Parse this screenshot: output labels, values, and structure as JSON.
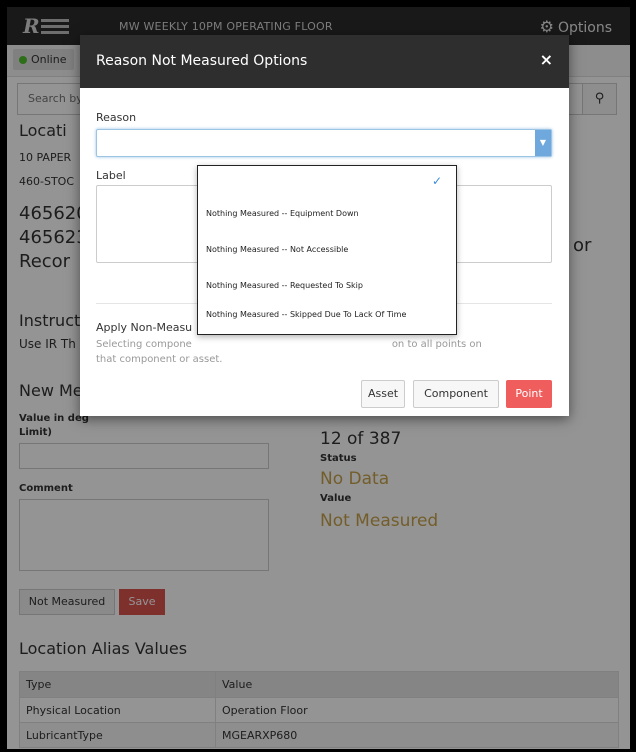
{
  "nav": {
    "logo_text": "Reliable Logic",
    "title": "MW WEEKLY 10PM OPERATING FLOOR",
    "options_label": "Options",
    "options_icon": "gear-icon"
  },
  "status": {
    "online_label": "Online",
    "online_color": "#4fbf2a"
  },
  "search": {
    "placeholder": "Search by",
    "button_icon": "search-icon"
  },
  "location": {
    "heading": "Locati",
    "line1": "10 PAPER",
    "line2": "460-STOC",
    "code1": "465620",
    "code2": "465623",
    "record": "Recor",
    "right_fragment": "or"
  },
  "instructions": {
    "heading": "Instruct",
    "text": "Use IR Th"
  },
  "new_measurement": {
    "heading": "New Me",
    "value_label_a": "Value in deg",
    "value_label_b": "Limit)",
    "comment_label": "Comment",
    "not_measured_button": "Not Measured",
    "save_button": "Save"
  },
  "point_info": {
    "count": "12 of 387",
    "status_label": "Status",
    "status_value": "No Data",
    "value_label": "Value",
    "value_value": "Not Measured"
  },
  "alias": {
    "heading": "Location Alias Values",
    "columns": [
      "Type",
      "Value"
    ],
    "rows": [
      [
        "Physical Location",
        "Operation Floor"
      ],
      [
        "LubricantType",
        "MGEARXP680"
      ]
    ]
  },
  "modal": {
    "title": "Reason Not Measured Options",
    "close_label": "×",
    "reason_label": "Reason",
    "label_label": "Label",
    "apply_title": "Apply Non-Measu",
    "apply_desc_line1": "Selecting compone",
    "apply_desc_line1_end": "on to all points on",
    "apply_desc_line2": "that component or asset.",
    "buttons": {
      "asset": "Asset",
      "component": "Component",
      "point": "Point"
    },
    "point_color": "#ef5d5d"
  },
  "dropdown": {
    "checked_icon": "check-icon",
    "options": [
      "Nothing Measured -- Equipment Down",
      "Nothing Measured -- Not Accessible",
      "Nothing Measured -- Requested To Skip",
      "Nothing Measured -- Skipped Due To Lack Of Time"
    ]
  }
}
